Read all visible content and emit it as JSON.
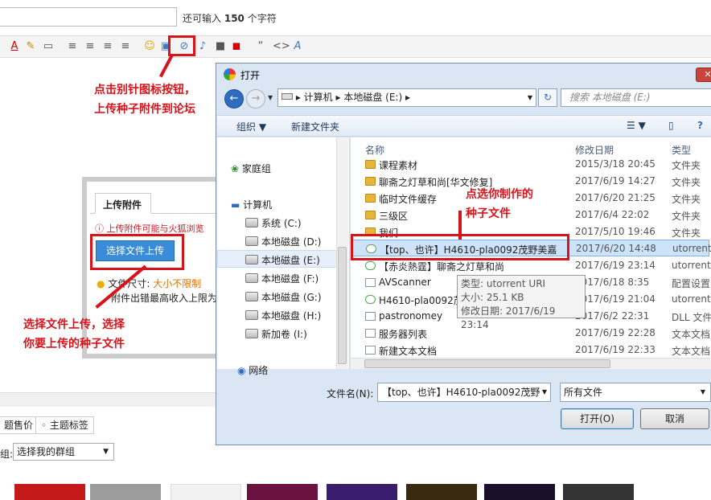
{
  "page": {
    "remain_prefix": "还可输入",
    "remain_count": "150",
    "remain_suffix": "个字符"
  },
  "annotations": {
    "note1_line1": "点击别针图标按钮，",
    "note1_line2": "上传种子附件到论坛",
    "note2_line1": "选择文件上传，选择",
    "note2_line2": "你要上传的种子文件",
    "note3_line1": "点选你制作的",
    "note3_line2": "种子文件",
    "accent_color": "#d8141b"
  },
  "upload": {
    "tab_label": "上传附件",
    "warning": "上传附件可能与火狐浏览",
    "button_label": "选择文件上传",
    "size_label": "文件尺寸:",
    "size_value": "大小不限制",
    "size_line2": "附件出错最高收入上限为"
  },
  "lower": {
    "seg1": "题售价",
    "seg2": "主题标签",
    "group_label": "组:",
    "group_select": "选择我的群组"
  },
  "dialog": {
    "title": "打开",
    "close_label": "✕",
    "address_parts": [
      "计算机",
      "本地磁盘 (E:)"
    ],
    "search_placeholder": "搜索 本地磁盘 (E:)",
    "cmd_organize": "组织 ▼",
    "cmd_new_folder": "新建文件夹",
    "nav_items": [
      {
        "label": "家庭组"
      },
      {
        "label": "计算机"
      },
      {
        "label": "系统 (C:)"
      },
      {
        "label": "本地磁盘 (D:)"
      },
      {
        "label": "本地磁盘 (E:)"
      },
      {
        "label": "本地磁盘 (F:)"
      },
      {
        "label": "本地磁盘 (G:)"
      },
      {
        "label": "本地磁盘 (H:)"
      },
      {
        "label": "新加卷 (I:)"
      },
      {
        "label": "网络"
      }
    ],
    "columns": {
      "name": "名称",
      "date": "修改日期",
      "type": "类型"
    },
    "rows": [
      {
        "name": "课程素材",
        "date": "2015/3/18 20:45",
        "type": "文件夹",
        "icon": "folder"
      },
      {
        "name": "聊斋之灯草和尚[华文修复]",
        "date": "2017/6/19 14:27",
        "type": "文件夹",
        "icon": "folder"
      },
      {
        "name": "临时文件缓存",
        "date": "2017/6/20 21:25",
        "type": "文件夹",
        "icon": "folder"
      },
      {
        "name": "三级区",
        "date": "2017/6/4 22:02",
        "type": "文件夹",
        "icon": "folder"
      },
      {
        "name": "我们",
        "date": "2017/5/10 19:46",
        "type": "文件夹",
        "icon": "folder"
      },
      {
        "name": "【top、也许】H4610-pla0092茂野美嘉",
        "date": "2017/6/20 14:48",
        "type": "utorrent",
        "icon": "utorrent"
      },
      {
        "name": "【赤炎熱霆】聊斋之灯草和尚",
        "date": "2017/6/19 23:14",
        "type": "utorrent",
        "icon": "utorrent"
      },
      {
        "name": "AVScanner",
        "date": "2017/6/18 8:35",
        "type": "配置设置",
        "icon": "doc"
      },
      {
        "name": "H4610-pla0092茂野美嘉",
        "date": "2017/6/19 21:04",
        "type": "utorrent",
        "icon": "utorrent"
      },
      {
        "name": "pastronomey",
        "date": "2017/6/2 22:31",
        "type": "DLL 文件",
        "icon": "doc"
      },
      {
        "name": "服务器列表",
        "date": "2017/6/19 22:28",
        "type": "文本文档",
        "icon": "doc"
      },
      {
        "name": "新建文本文档",
        "date": "2017/6/19 22:33",
        "type": "文本文档",
        "icon": "doc"
      }
    ],
    "tooltip": {
      "line1": "类型: utorrent URI",
      "line2": "大小: 25.1 KB",
      "line3": "修改日期: 2017/6/19 23:14"
    },
    "filename_label": "文件名(N):",
    "filename_value": "【top、也许】H4610-pla0092茂野",
    "filetype_value": "所有文件",
    "open_button": "打开(O)",
    "cancel_button": "取消"
  }
}
